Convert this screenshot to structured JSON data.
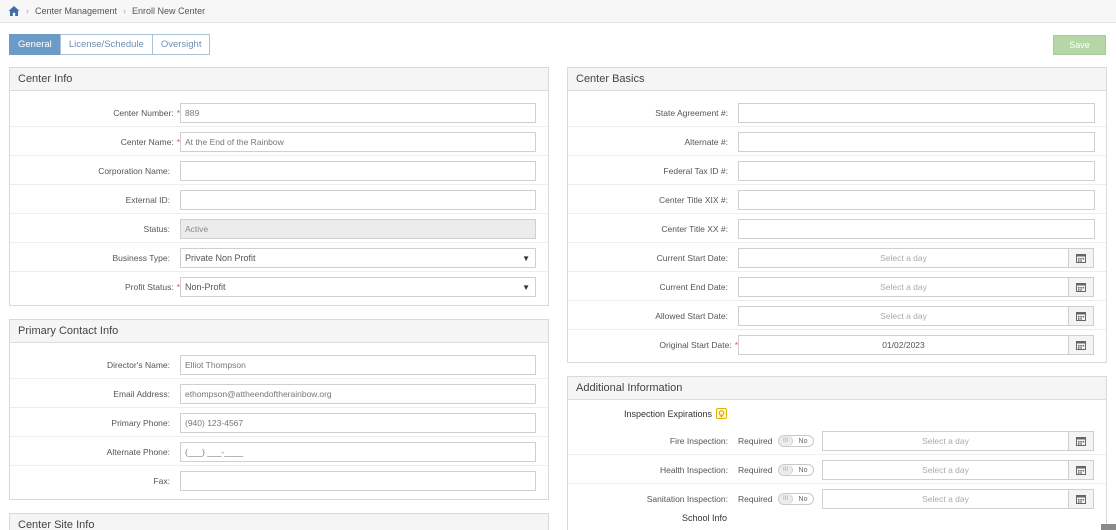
{
  "breadcrumb": {
    "items": [
      "Center Management",
      "Enroll New Center"
    ],
    "home_icon": "home-icon"
  },
  "tabs": [
    {
      "label": "General",
      "active": true
    },
    {
      "label": "License/Schedule",
      "active": false
    },
    {
      "label": "Oversight",
      "active": false
    }
  ],
  "toolbar": {
    "save_label": "Save"
  },
  "center_info": {
    "title": "Center Info",
    "center_number": {
      "label": "Center Number:",
      "value": "889",
      "required": "*"
    },
    "center_name": {
      "label": "Center Name:",
      "value": "At the End of the Rainbow",
      "required": "*"
    },
    "corporation_name": {
      "label": "Corporation Name:",
      "value": ""
    },
    "external_id": {
      "label": "External ID:",
      "value": ""
    },
    "status": {
      "label": "Status:",
      "value": "Active"
    },
    "business_type": {
      "label": "Business Type:",
      "value": "Private Non Profit"
    },
    "profit_status": {
      "label": "Profit Status:",
      "value": "Non-Profit",
      "required": "*"
    }
  },
  "primary_contact": {
    "title": "Primary Contact Info",
    "director_name": {
      "label": "Director's Name:",
      "value": "Elliot Thompson"
    },
    "email": {
      "label": "Email Address:",
      "value": "ethompson@attheendoftherainbow.org"
    },
    "primary_phone": {
      "label": "Primary Phone:",
      "value": "(940) 123-4567"
    },
    "alternate_phone": {
      "label": "Alternate Phone:",
      "value": "(___) ___-____"
    },
    "fax": {
      "label": "Fax:",
      "value": ""
    }
  },
  "center_site": {
    "title": "Center Site Info"
  },
  "center_basics": {
    "title": "Center Basics",
    "state_agreement": {
      "label": "State Agreement #:",
      "value": ""
    },
    "alternate": {
      "label": "Alternate #:",
      "value": ""
    },
    "federal_tax_id": {
      "label": "Federal Tax ID #:",
      "value": ""
    },
    "title_xix": {
      "label": "Center Title XIX #:",
      "value": ""
    },
    "title_xx": {
      "label": "Center Title XX #:",
      "value": ""
    },
    "current_start": {
      "label": "Current Start Date:",
      "placeholder": "Select a day"
    },
    "current_end": {
      "label": "Current End Date:",
      "placeholder": "Select a day"
    },
    "allowed_start": {
      "label": "Allowed Start Date:",
      "placeholder": "Select a day"
    },
    "original_start": {
      "label": "Original Start Date:",
      "value": "01/02/2023",
      "required": "*"
    }
  },
  "additional_info": {
    "title": "Additional Information",
    "inspection_heading": "Inspection Expirations",
    "required_label": "Required",
    "toggle_off_label": "No",
    "fire": {
      "label": "Fire Inspection:",
      "placeholder": "Select a day"
    },
    "health": {
      "label": "Health Inspection:",
      "placeholder": "Select a day"
    },
    "sanitation": {
      "label": "Sanitation Inspection:",
      "placeholder": "Select a day"
    },
    "school_heading": "School Info"
  },
  "colors": {
    "tab_active": "#6d9bc7",
    "save_button": "#b5d6a5",
    "required_marker": "#d9534f"
  }
}
